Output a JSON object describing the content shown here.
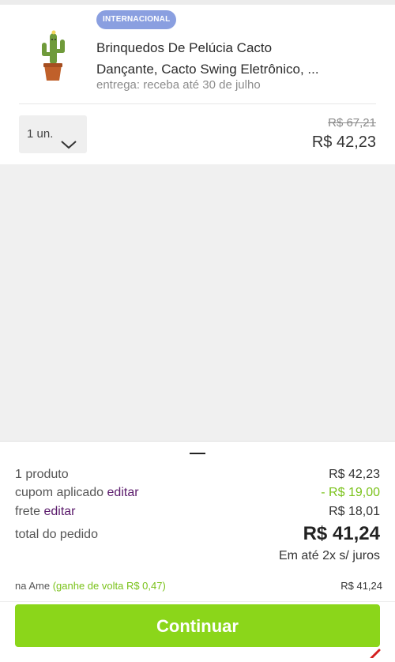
{
  "item": {
    "badge": "INTERNACIONAL",
    "title_line1": "Brinquedos De Pelúcia Cacto",
    "title_line2": "Dançante, Cacto Swing Eletrônico, ...",
    "delivery": "entrega: receba até 30 de julho",
    "quantity": "1 un.",
    "old_price": "R$ 67,21",
    "price": "R$ 42,23",
    "thumb_icon": "cactus-toy-icon"
  },
  "summary": {
    "products_label": "1 produto",
    "products_value": "R$ 42,23",
    "coupon_label": "cupom aplicado",
    "coupon_edit": "editar",
    "coupon_value": "- R$ 19,00",
    "shipping_label": "frete",
    "shipping_edit": "editar",
    "shipping_value": "R$ 18,01",
    "total_label": "total do pedido",
    "total_value": "R$ 41,24",
    "installments": "Em até 2x s/ juros",
    "ame_label": "na Ame",
    "ame_cashback": "(ganhe de volta R$ 0,47)",
    "ame_value": "R$ 41,24",
    "continue_label": "Continuar"
  },
  "colors": {
    "badge": "#8a9fe0",
    "accent_green": "#8bd61a",
    "edit_purple": "#5a1a6b"
  }
}
